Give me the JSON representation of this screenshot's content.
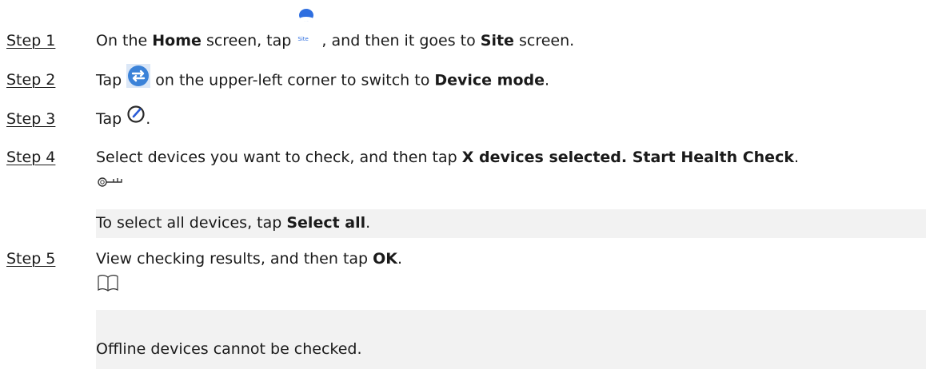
{
  "steps": [
    {
      "label": "Step 1",
      "t1": "On the ",
      "b1": "Home",
      "t2": "  screen, tap ",
      "icon_caption": "Site",
      "t3": " , and then it goes to ",
      "b2": "Site",
      "t4": " screen."
    },
    {
      "label": "Step 2",
      "t1": "Tap ",
      "t2": " on the upper-left corner to switch to ",
      "b1": "Device mode",
      "t3": "."
    },
    {
      "label": "Step 3",
      "t1": "Tap ",
      "t2": "."
    },
    {
      "label": "Step 4",
      "t1": "Select devices you want to check, and then tap ",
      "b1": "X devices selected. Start Health Check",
      "t2": ".",
      "note": {
        "icon": "key-icon",
        "t1": "To select all devices, tap ",
        "b1": "Select all",
        "t2": "."
      }
    },
    {
      "label": "Step 5",
      "t1": "View checking results, and then tap ",
      "b1": "OK",
      "t2": ".",
      "note": {
        "icon": "book-icon",
        "t1": "Offline devices cannot be checked."
      }
    }
  ],
  "colors": {
    "site_icon": "#2f6fe0",
    "switch_icon": "#3b82d8",
    "check_icon": "#2a5bd7",
    "note_bg": "#f2f2f2"
  }
}
